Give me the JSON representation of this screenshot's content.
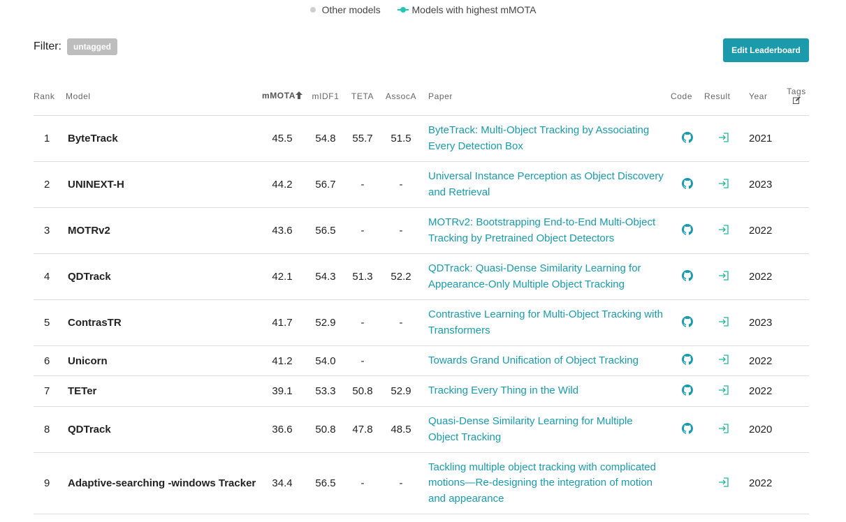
{
  "legend": {
    "other": "Other models",
    "highest": "Models with highest mMOTA"
  },
  "filter": {
    "label": "Filter:",
    "tag": "untagged"
  },
  "edit_button": "Edit Leaderboard",
  "headers": {
    "rank": "Rank",
    "model": "Model",
    "mmota": "mMOTA",
    "midf1": "mIDF1",
    "teta": "TETA",
    "assoca": "AssocA",
    "paper": "Paper",
    "code": "Code",
    "result": "Result",
    "year": "Year",
    "tags": "Tags"
  },
  "rows": [
    {
      "rank": "1",
      "model": "ByteTrack",
      "mmota": "45.5",
      "midf1": "54.8",
      "teta": "55.7",
      "assoca": "51.5",
      "paper": "ByteTrack: Multi-Object Tracking by Associating Every Detection Box",
      "has_code": true,
      "year": "2021"
    },
    {
      "rank": "2",
      "model": "UNINEXT-H",
      "mmota": "44.2",
      "midf1": "56.7",
      "teta": "-",
      "assoca": "-",
      "paper": "Universal Instance Perception as Object Discovery and Retrieval",
      "has_code": true,
      "year": "2023"
    },
    {
      "rank": "3",
      "model": "MOTRv2",
      "mmota": "43.6",
      "midf1": "56.5",
      "teta": "-",
      "assoca": "-",
      "paper": "MOTRv2: Bootstrapping End-to-End Multi-Object Tracking by Pretrained Object Detectors",
      "has_code": true,
      "year": "2022"
    },
    {
      "rank": "4",
      "model": "QDTrack",
      "mmota": "42.1",
      "midf1": "54.3",
      "teta": "51.3",
      "assoca": "52.2",
      "paper": "QDTrack: Quasi-Dense Similarity Learning for Appearance-Only Multiple Object Tracking",
      "has_code": true,
      "year": "2022"
    },
    {
      "rank": "5",
      "model": "ContrasTR",
      "mmota": "41.7",
      "midf1": "52.9",
      "teta": "-",
      "assoca": "-",
      "paper": "Contrastive Learning for Multi-Object Tracking with Transformers",
      "has_code": true,
      "year": "2023"
    },
    {
      "rank": "6",
      "model": "Unicorn",
      "mmota": "41.2",
      "midf1": "54.0",
      "teta": "-",
      "assoca": "",
      "paper": "Towards Grand Unification of Object Tracking",
      "has_code": true,
      "year": "2022"
    },
    {
      "rank": "7",
      "model": "TETer",
      "mmota": "39.1",
      "midf1": "53.3",
      "teta": "50.8",
      "assoca": "52.9",
      "paper": "Tracking Every Thing in the Wild",
      "has_code": true,
      "year": "2022"
    },
    {
      "rank": "8",
      "model": "QDTrack",
      "mmota": "36.6",
      "midf1": "50.8",
      "teta": "47.8",
      "assoca": "48.5",
      "paper": "Quasi-Dense Similarity Learning for Multiple Object Tracking",
      "has_code": true,
      "year": "2020"
    },
    {
      "rank": "9",
      "model": "Adaptive-searching -windows Tracker",
      "mmota": "34.4",
      "midf1": "56.5",
      "teta": "-",
      "assoca": "-",
      "paper": "Tackling multiple object tracking with complicated motions—Re-designing the integration of motion and appearance",
      "has_code": false,
      "year": "2022"
    }
  ],
  "colors": {
    "accent": "#1a9aab",
    "highlight": "#21c7b1",
    "badge": "#bdbdbd"
  },
  "icons": {
    "code": "github-icon",
    "result": "result-link-icon",
    "tags": "edit-icon",
    "sort": "sort-up-icon"
  }
}
